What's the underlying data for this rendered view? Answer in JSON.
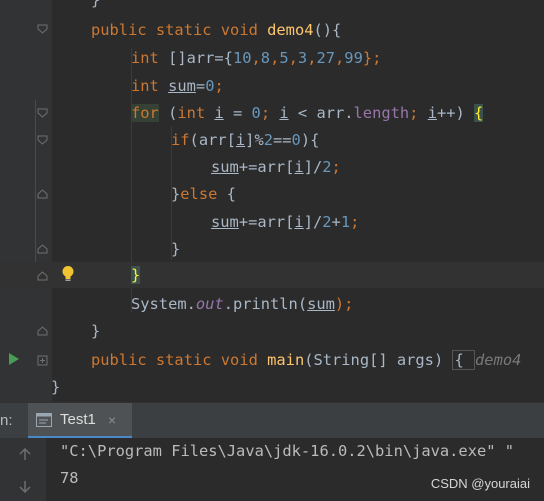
{
  "editor": {
    "lines": {
      "l0": {
        "brace": "}"
      },
      "l1": {
        "kw1": "public",
        "kw2": "static",
        "kw3": "void",
        "fn": "demo4",
        "rest": "(){"
      },
      "l2": {
        "kw": "int",
        "a": " []arr={",
        "n1": "10",
        "c1": ",",
        "n2": "8",
        "c2": ",",
        "n3": "5",
        "c3": ",",
        "n4": "3",
        "c4": ",",
        "n5": "27",
        "c5": ",",
        "n6": "99",
        "end": "};"
      },
      "l3": {
        "kw": "int",
        "sp": " ",
        "var": "sum",
        "eq": "=",
        "num": "0",
        "semi": ";"
      },
      "l4": {
        "kw_for": "for",
        "p1": " (",
        "kw_int": "int",
        "sp": " ",
        "i1": "i",
        "eq": " = ",
        "zero": "0",
        "semi1": "; ",
        "i2": "i",
        "lt": " < arr.",
        "field": "length",
        "semi2": "; ",
        "i3": "i",
        "inc": "++) ",
        "brace": "{"
      },
      "l5": {
        "kw": "if",
        "a": "(arr[",
        "i": "i",
        "b": "]%",
        "n1": "2",
        "c": "==",
        "n2": "0",
        "d": "){"
      },
      "l6": {
        "var": "sum",
        "a": "+=arr[",
        "i": "i",
        "b": "]/",
        "n": "2",
        "c": ";"
      },
      "l7": {
        "a": "}",
        "kw": "else",
        "b": " {"
      },
      "l8": {
        "var": "sum",
        "a": "+=arr[",
        "i": "i",
        "b": "]/",
        "n1": "2",
        "plus": "+",
        "n2": "1",
        "c": ";"
      },
      "l9": {
        "brace": "}"
      },
      "l10": {
        "brace": "}"
      },
      "l11": {
        "a": "System.",
        "out": "out",
        "b": ".println(",
        "var": "sum",
        "c": ");"
      },
      "l12": {
        "brace": "}"
      },
      "l13": {
        "kw1": "public",
        "kw2": "static",
        "kw3": "void",
        "fn": "main",
        "a": "(String[] args) ",
        "b": "{ ",
        "hint": "demo4"
      },
      "l14": {
        "brace": "}"
      }
    }
  },
  "run_toolbar": {
    "label": "n:",
    "tab_label": "Test1",
    "close_glyph": "×"
  },
  "console": {
    "line1": "\"C:\\Program Files\\Java\\jdk-16.0.2\\bin\\java.exe\" \"",
    "line2": "78"
  },
  "watermark": "CSDN @youraiai",
  "icons": {
    "run": "run-icon",
    "bulb": "lightbulb-icon",
    "fold": "fold-marker-icon",
    "up": "arrow-up-icon",
    "down": "arrow-down-icon",
    "tab": "console-tab-icon"
  },
  "colors": {
    "background": "#2b2b2b",
    "keyword": "#cc7832",
    "function": "#ffc66d",
    "number": "#6897bb",
    "field": "#9876aa",
    "text": "#a9b7c6",
    "run_green": "#499c54"
  }
}
